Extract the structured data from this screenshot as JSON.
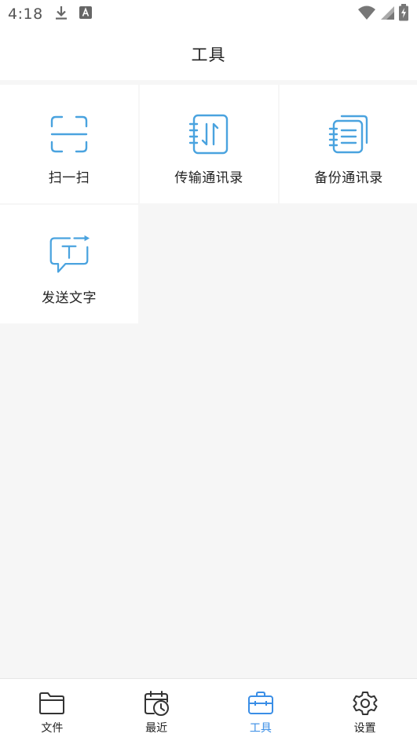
{
  "status_bar": {
    "time": "4:18",
    "icons_left": [
      "download-icon",
      "app-a-icon"
    ],
    "icons_right": [
      "wifi-icon",
      "signal-icon",
      "battery-charging-icon"
    ]
  },
  "app_bar": {
    "title": "工具"
  },
  "tools": [
    {
      "label": "扫一扫",
      "icon": "scan-icon"
    },
    {
      "label": "传输通讯录",
      "icon": "transfer-contacts-icon"
    },
    {
      "label": "备份通讯录",
      "icon": "backup-contacts-icon"
    },
    {
      "label": "发送文字",
      "icon": "send-text-icon"
    }
  ],
  "bottom_nav": {
    "active": 2,
    "items": [
      {
        "label": "文件",
        "icon": "folder-icon"
      },
      {
        "label": "最近",
        "icon": "recent-calendar-icon"
      },
      {
        "label": "工具",
        "icon": "toolbox-icon"
      },
      {
        "label": "设置",
        "icon": "gear-icon"
      }
    ]
  },
  "colors": {
    "accent": "#3a8ee6",
    "icon_blue": "#4aa3df",
    "nav_icon_dark": "#333333",
    "background": "#f6f6f6",
    "tile": "#ffffff"
  }
}
